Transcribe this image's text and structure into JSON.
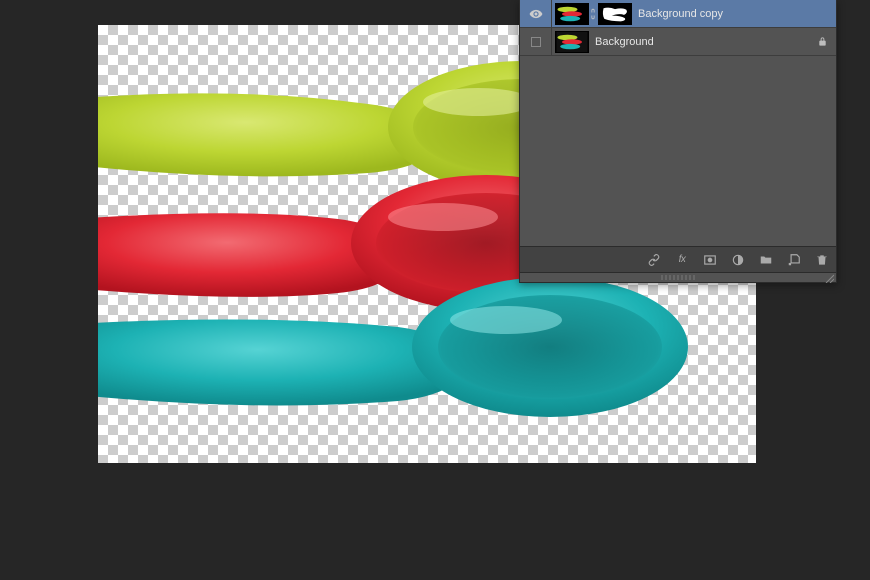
{
  "canvas": {
    "spoons": [
      {
        "color": "#bdd633",
        "shade": "#9db81e",
        "highlight": "#d9e872"
      },
      {
        "color": "#e32835",
        "shade": "#b3131f",
        "highlight": "#f26b72"
      },
      {
        "color": "#1db2b4",
        "shade": "#0f8b8d",
        "highlight": "#56d3d4"
      }
    ]
  },
  "layersPanel": {
    "layers": [
      {
        "name": "Background copy",
        "visible": true,
        "selected": true,
        "hasMask": true,
        "locked": false
      },
      {
        "name": "Background",
        "visible": false,
        "selected": false,
        "hasMask": false,
        "locked": true
      }
    ],
    "bottomTools": {
      "link": "link-layers",
      "fx": "fx",
      "mask": "add-mask",
      "adjustment": "new-adjustment-layer",
      "group": "new-group",
      "new": "new-layer",
      "delete": "delete-layer"
    }
  }
}
